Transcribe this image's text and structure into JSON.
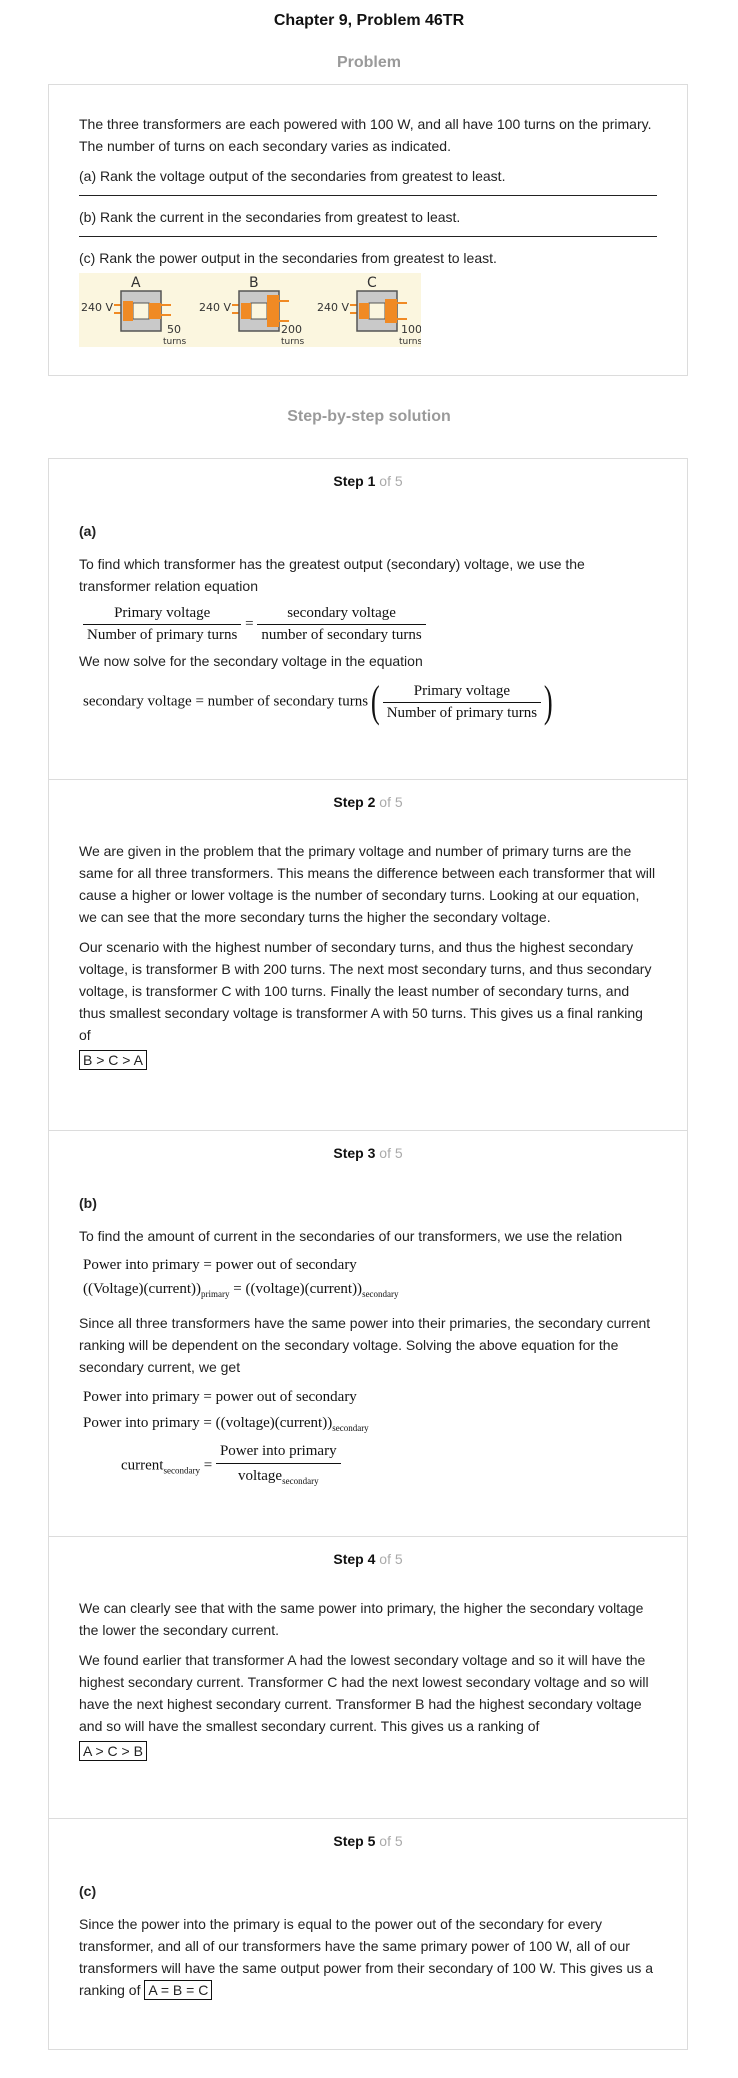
{
  "header": {
    "title": "Chapter 9, Problem 46TR"
  },
  "problem": {
    "heading": "Problem",
    "intro": "The three transformers are each powered with 100 W, and all have 100 turns on the primary. The number of turns on each secondary varies as indicated.",
    "part_a": "(a) Rank the voltage output of the secondaries from greatest to least.",
    "part_b": "(b) Rank the current in the secondaries from greatest to least.",
    "part_c": "(c) Rank the power output in the secondaries from greatest to least.",
    "figure": {
      "transformers": [
        {
          "letter": "A",
          "voltage": "240 V",
          "turns": "50",
          "unit": "turns"
        },
        {
          "letter": "B",
          "voltage": "240 V",
          "turns": "200",
          "unit": "turns"
        },
        {
          "letter": "C",
          "voltage": "240 V",
          "turns": "100",
          "unit": "turns"
        }
      ],
      "colors": {
        "background": "#fbf6df",
        "coil": "#f08a24",
        "core": "#c9c9c9"
      }
    }
  },
  "solution": {
    "heading": "Step-by-step solution",
    "of_text": "of 5",
    "steps": [
      {
        "label": "Step",
        "number": "1",
        "part": "(a)",
        "p1": "To find which transformer has the greatest output (secondary) voltage, we use the transformer relation equation",
        "eq1": {
          "num_left": "Primary voltage",
          "den_left": "Number of primary turns",
          "equals": "=",
          "num_right": "secondary voltage",
          "den_right": "number of secondary turns"
        },
        "p2": "We now solve for the secondary voltage in the equation",
        "eq2": {
          "lhs": "secondary voltage = number of secondary turns",
          "num": "Primary voltage",
          "den": "Number of primary turns"
        }
      },
      {
        "label": "Step",
        "number": "2",
        "p1": "We are given in the problem that the primary voltage and number of primary turns are the same for all three transformers. This means the difference between each transformer that will cause a higher or lower voltage is the number of secondary turns. Looking at our equation, we can see that the more secondary turns the higher the secondary voltage.",
        "p2": "Our scenario with the highest number of secondary turns, and thus the highest secondary voltage, is transformer B with 200 turns. The next most secondary turns, and thus secondary voltage, is transformer C with 100 turns. Finally the least number of secondary turns, and thus smallest secondary voltage is transformer A with 50 turns. This gives us a final ranking of",
        "answer": "B > C > A"
      },
      {
        "label": "Step",
        "number": "3",
        "part": "(b)",
        "p1": "To find the amount of current in the secondaries of our transformers, we use the relation",
        "eq1_line1": "Power into primary = power out of secondary",
        "eq1_line2_left": "((Voltage)(current))",
        "eq1_line2_sub_left": "primary",
        "eq1_line2_mid": " = ((voltage)(current))",
        "eq1_line2_sub_right": "secondary",
        "p2": "Since all three transformers have the same power into their primaries, the secondary current ranking will be dependent on the secondary voltage. Solving the above equation for the secondary current, we get",
        "eq2_line1": "Power into primary = power out of secondary",
        "eq2_line2": "Power into primary = ((voltage)(current))",
        "eq2_line2_sub": "secondary",
        "eq2_line3_lhs": "current",
        "eq2_line3_lhs_sub": "secondary",
        "eq2_line3_eq": " = ",
        "eq2_line3_num": "Power into primary",
        "eq2_line3_den": "voltage",
        "eq2_line3_den_sub": "secondary"
      },
      {
        "label": "Step",
        "number": "4",
        "p1": "We can clearly see that with the same power into primary, the higher the secondary voltage the lower the secondary current.",
        "p2": "We found earlier that transformer A had the lowest secondary voltage and so it will have the highest secondary current. Transformer C had the next lowest secondary voltage and so will have the next highest secondary current. Transformer B had the highest secondary voltage and so will have the smallest secondary current. This gives us a ranking of",
        "answer": "A > C > B"
      },
      {
        "label": "Step",
        "number": "5",
        "part": "(c)",
        "p1": "Since the power into the primary is equal to the power out of the secondary for every transformer, and all of our transformers have the same primary power of 100 W, all of our transformers will have the same output power from their secondary of 100 W. This gives us a ranking of",
        "answer": "A = B = C"
      }
    ]
  }
}
